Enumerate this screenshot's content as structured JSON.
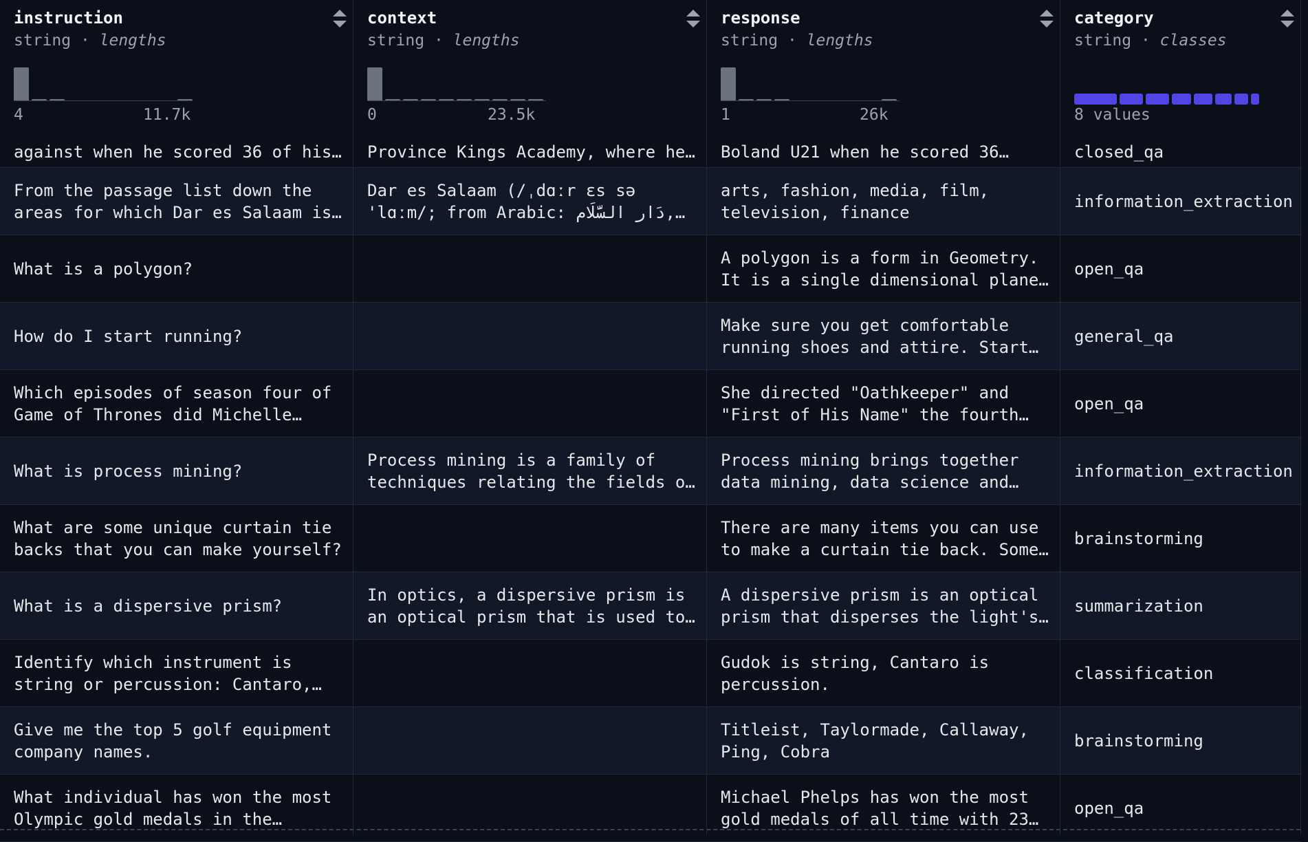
{
  "columns": [
    {
      "name": "instruction",
      "type": "string",
      "stat": "lengths",
      "min": "4",
      "max": "11.7k"
    },
    {
      "name": "context",
      "type": "string",
      "stat": "lengths",
      "min": "0",
      "max": "23.5k"
    },
    {
      "name": "response",
      "type": "string",
      "stat": "lengths",
      "min": "1",
      "max": "26k"
    },
    {
      "name": "category",
      "type": "string",
      "stat": "classes",
      "classes_label": "8 values"
    }
  ],
  "rows": [
    {
      "instruction": "against when he scored 36 of his…",
      "context": "Province Kings Academy, where he…",
      "response": "Boland U21 when he scored 36…",
      "category": "closed_qa"
    },
    {
      "instruction": "From the passage list down the\nareas for which Dar es Salaam is…",
      "context": "Dar es Salaam (/ˌdɑːr ɛs sə\n'lɑːm/; from Arabic: دَار السَّلَام,…",
      "response": "arts, fashion, media, film,\ntelevision, finance",
      "category": "information_extraction"
    },
    {
      "instruction": "What is a polygon?",
      "context": "",
      "response": "A polygon is a form in Geometry.\nIt is a single dimensional plane…",
      "category": "open_qa"
    },
    {
      "instruction": "How do I start running?",
      "context": "",
      "response": "Make sure you get comfortable\nrunning shoes and attire. Start…",
      "category": "general_qa"
    },
    {
      "instruction": "Which episodes of season four of\nGame of Thrones did Michelle…",
      "context": "",
      "response": "She directed \"Oathkeeper\" and\n\"First of His Name\" the fourth…",
      "category": "open_qa"
    },
    {
      "instruction": "What is process mining?",
      "context": "Process mining is a family of\ntechniques relating the fields o…",
      "response": "Process mining brings together\ndata mining, data science and…",
      "category": "information_extraction"
    },
    {
      "instruction": "What are some unique curtain tie\nbacks that you can make yourself?",
      "context": "",
      "response": "There are many items you can use\nto make a curtain tie back. Some…",
      "category": "brainstorming"
    },
    {
      "instruction": "What is a dispersive prism?",
      "context": "In optics, a dispersive prism is\nan optical prism that is used to…",
      "response": "A dispersive prism is an optical\nprism that disperses the light's…",
      "category": "summarization"
    },
    {
      "instruction": "Identify which instrument is\nstring or percussion: Cantaro,…",
      "context": "",
      "response": "Gudok is string, Cantaro is\npercussion.",
      "category": "classification"
    },
    {
      "instruction": "Give me the top 5 golf equipment\ncompany names.",
      "context": "",
      "response": "Titleist, Taylormade, Callaway,\nPing, Cobra",
      "category": "brainstorming"
    },
    {
      "instruction": "What individual has won the most\nOlympic gold medals in the…",
      "context": "",
      "response": "Michael Phelps has won the most\ngold medals of all time with 23…",
      "category": "open_qa"
    }
  ],
  "colors": {
    "background": "#0b0f19",
    "row_alt": "#111827",
    "border": "#1f2937",
    "histogram": "#6b7280",
    "class_bar": "#4f46e5"
  }
}
